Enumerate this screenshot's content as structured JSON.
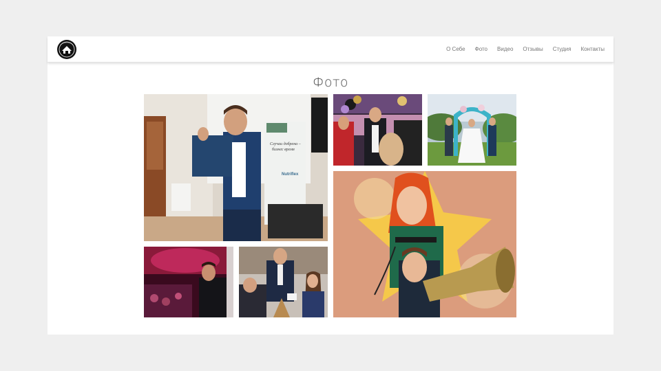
{
  "nav": {
    "items": [
      {
        "id": "about",
        "label": "О Себе"
      },
      {
        "id": "photo",
        "label": "Фото"
      },
      {
        "id": "video",
        "label": "Видео"
      },
      {
        "id": "reviews",
        "label": "Отзывы"
      },
      {
        "id": "studio",
        "label": "Студия"
      },
      {
        "id": "contacts",
        "label": "Контакты"
      }
    ]
  },
  "page": {
    "title": "Фото"
  },
  "gallery": {
    "banner_text_line1": "Случаи добрена –",
    "banner_text_line2": "бизнес время",
    "banner_brand": "Nutriflex"
  },
  "colors": {
    "background": "#efefef",
    "card": "#ffffff",
    "nav_text": "#777777",
    "title_text": "#4a4a4a"
  },
  "icons": {
    "logo": "emblem-logo"
  }
}
